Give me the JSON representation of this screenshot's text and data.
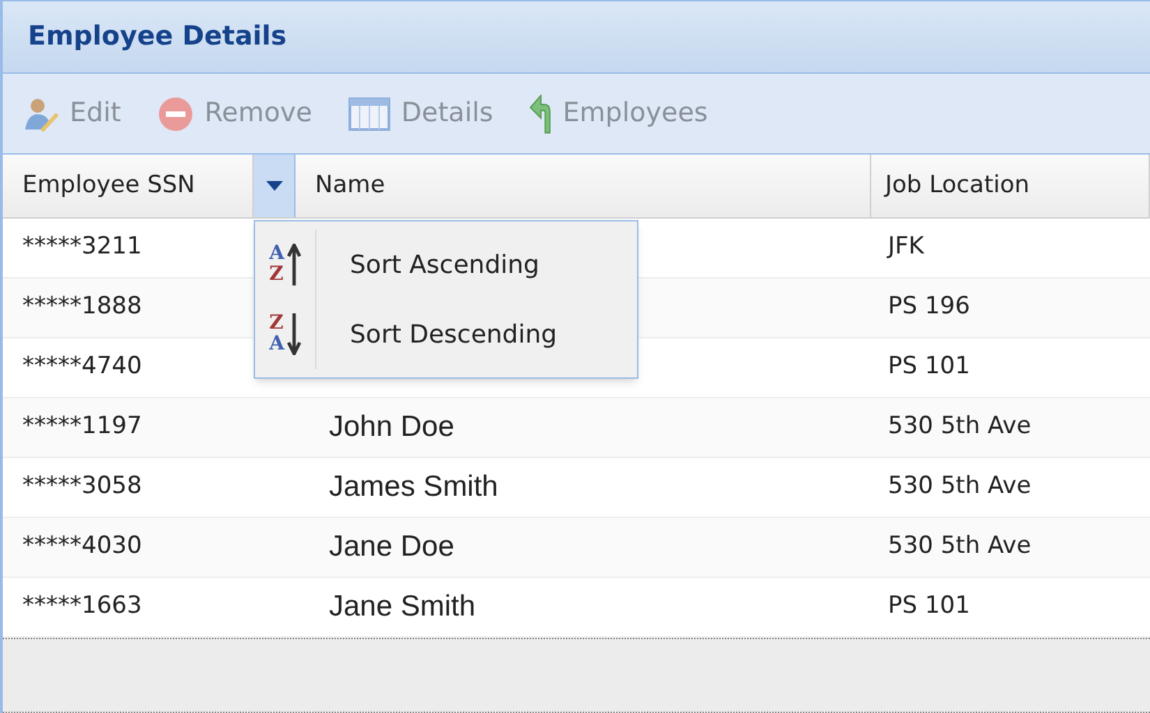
{
  "panel": {
    "title": "Employee Details"
  },
  "toolbar": [
    {
      "label": "Edit",
      "disabled": true
    },
    {
      "label": "Remove",
      "disabled": true
    },
    {
      "label": "Details",
      "disabled": true
    },
    {
      "label": "Employees",
      "disabled": true
    }
  ],
  "table": {
    "columns": [
      "Employee SSN",
      "Name",
      "Job Location"
    ],
    "rows": [
      {
        "ssn": "*****3211",
        "location": "JFK"
      },
      {
        "ssn": "*****1888",
        "location": "PS 196"
      },
      {
        "ssn": "*****4740",
        "location": "PS 101"
      },
      {
        "ssn": "*****1197",
        "name": "John Doe",
        "location": "530 5th Ave"
      },
      {
        "ssn": "*****3058",
        "name": "James Smith",
        "location": "530 5th Ave"
      },
      {
        "ssn": "*****4030",
        "name": "Jane Doe",
        "location": "530 5th Ave"
      },
      {
        "ssn": "*****1663",
        "name": "Jane Smith",
        "location": "PS 101"
      }
    ]
  },
  "column_menu": {
    "items": [
      {
        "label": "Sort Ascending",
        "kind": "asc",
        "letters": [
          "A",
          "Z"
        ]
      },
      {
        "label": "Sort Descending",
        "kind": "desc",
        "letters": [
          "Z",
          "A"
        ]
      }
    ]
  }
}
